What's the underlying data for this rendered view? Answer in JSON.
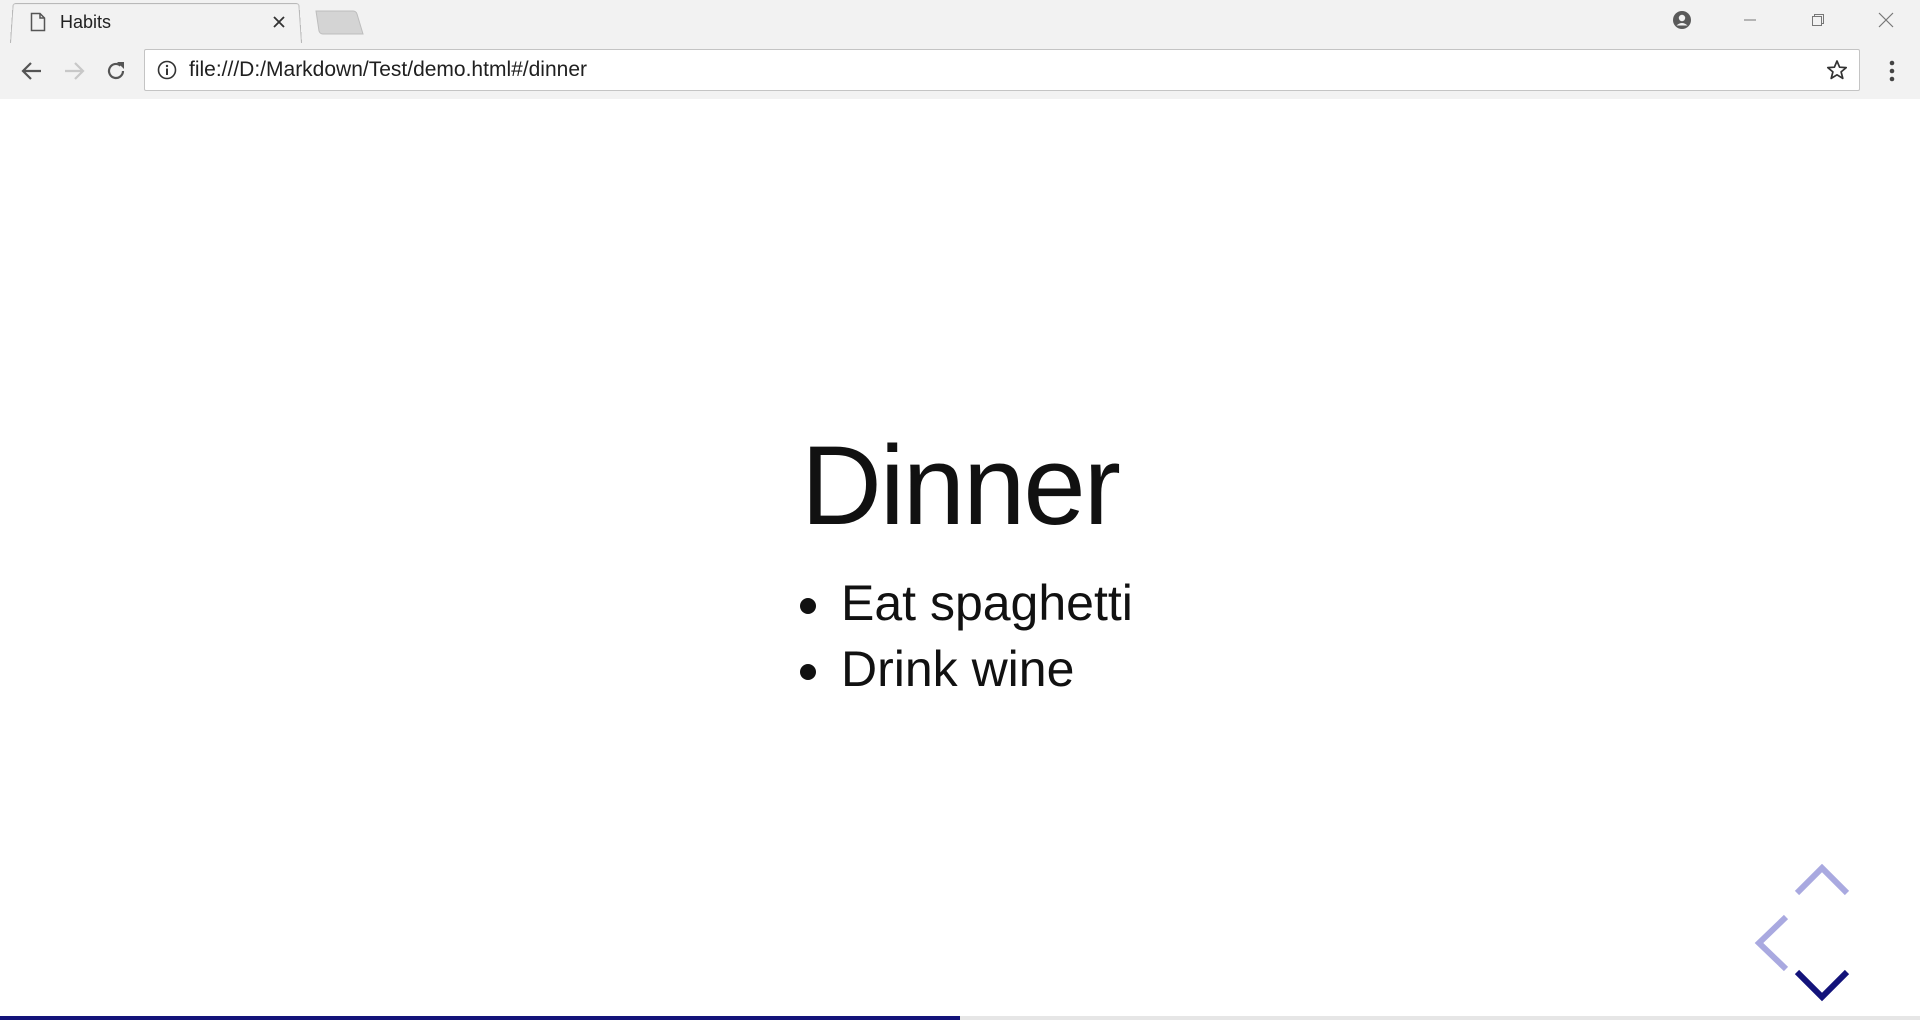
{
  "browser": {
    "tab_title": "Habits",
    "url": "file:///D:/Markdown/Test/demo.html#/dinner"
  },
  "slide": {
    "title": "Dinner",
    "items": [
      "Eat spaghetti",
      "Drink wine"
    ]
  },
  "controls": {
    "up_enabled": false,
    "left_enabled": false,
    "down_enabled": true,
    "enabled_color": "#13137a",
    "disabled_color": "#a9a9e0"
  },
  "progress": {
    "fraction": 0.5,
    "color": "#13137a"
  },
  "icons": [
    "page-icon",
    "close-icon",
    "new-tab-icon",
    "profile-icon",
    "minimize-icon",
    "restore-icon",
    "window-close-icon",
    "back-icon",
    "forward-icon",
    "reload-icon",
    "info-icon",
    "star-icon",
    "menu-icon",
    "chevron-up-icon",
    "chevron-left-icon",
    "chevron-down-icon"
  ]
}
